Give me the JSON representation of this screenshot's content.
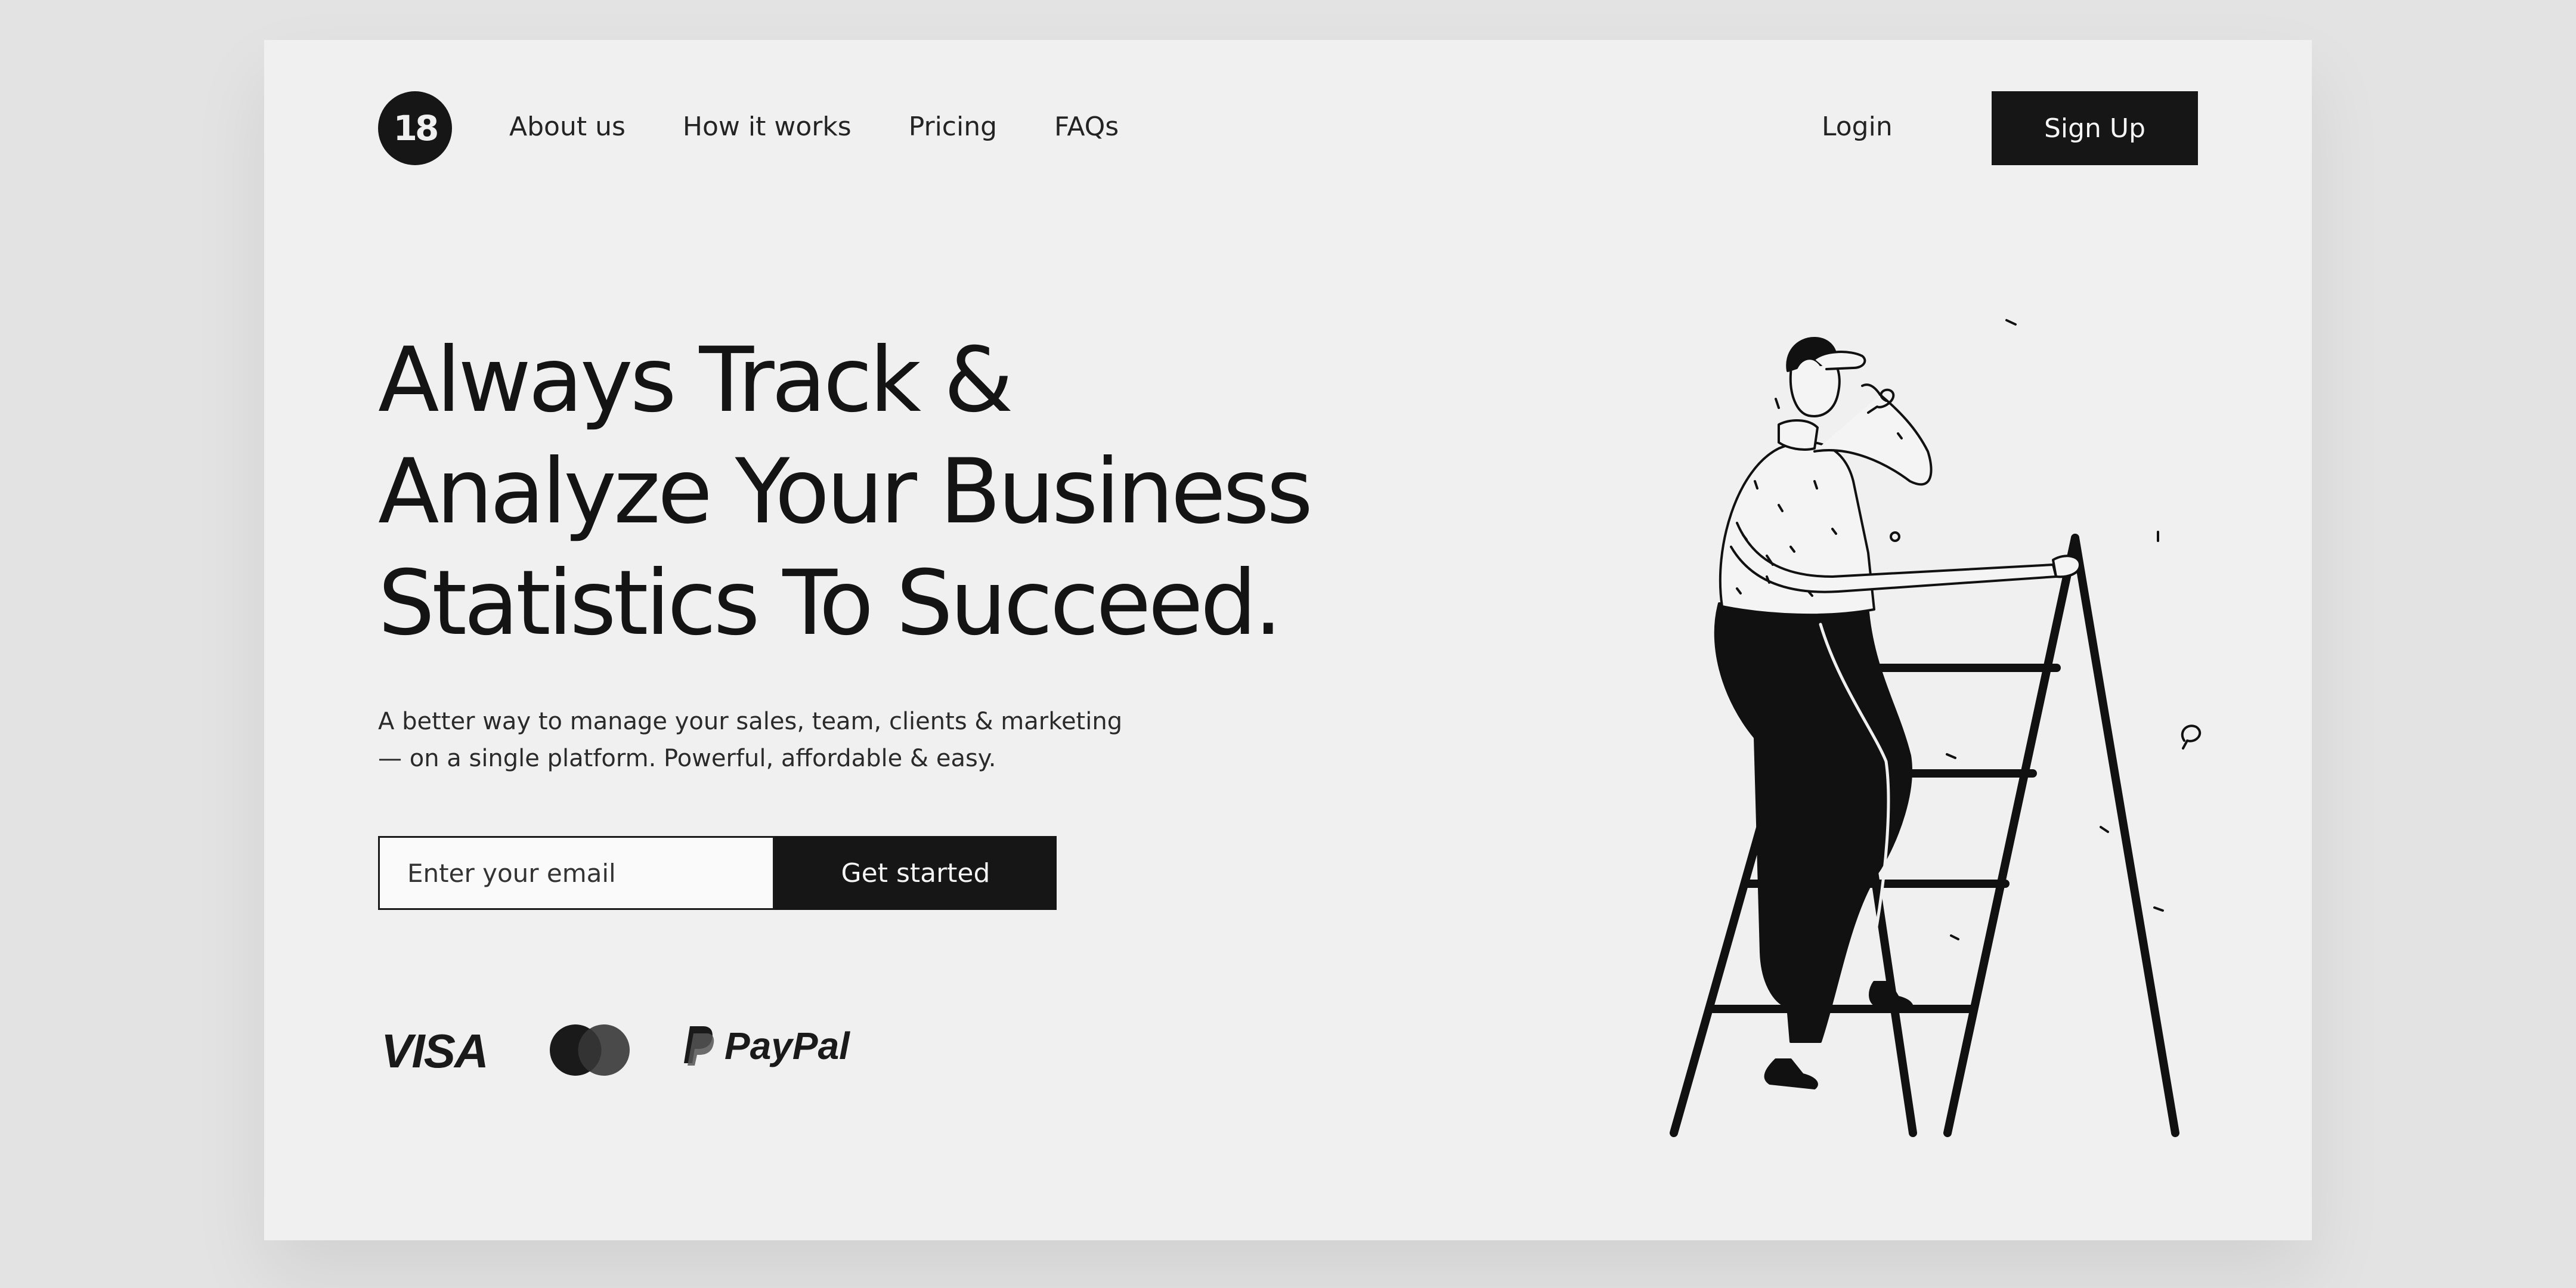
{
  "brand": {
    "logo_text": "18"
  },
  "nav": {
    "links": [
      "About us",
      "How it works",
      "Pricing",
      "FAQs"
    ],
    "login_label": "Login",
    "signup_label": "Sign Up"
  },
  "hero": {
    "headline_lines": [
      "Always Track &",
      "Analyze Your Business",
      "Statistics To Succeed."
    ],
    "subtext_lines": [
      "A better way to manage your sales, team, clients & marketing",
      "— on a single platform. Powerful, affordable & easy."
    ],
    "email_placeholder": "Enter your email",
    "cta_label": "Get started"
  },
  "payments": {
    "visa": "VISA",
    "paypal": "PayPal"
  },
  "icons": {
    "logo": "brand-logo-icon",
    "mastercard": "mastercard-icon",
    "paypal": "paypal-icon"
  },
  "colors": {
    "page_background": "#f0f0f0",
    "outer_background": "#e3e3e3",
    "primary_dark": "#161616",
    "text": "#1a1a1a"
  }
}
